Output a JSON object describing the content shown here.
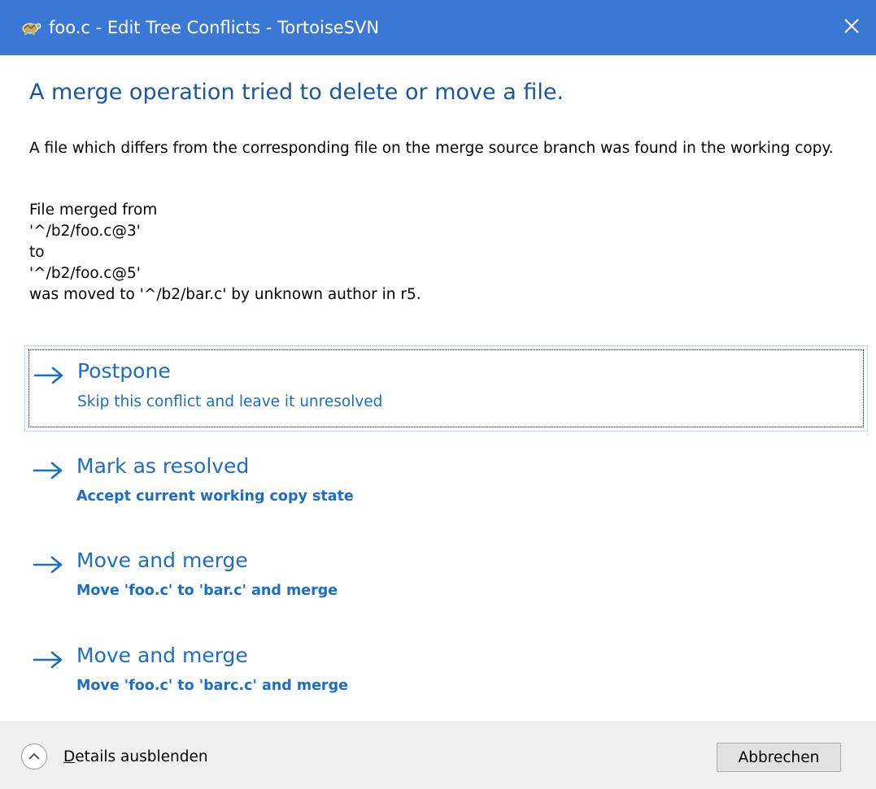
{
  "window": {
    "title": "foo.c - Edit Tree Conflicts - TortoiseSVN",
    "app_icon": "tortoise-icon",
    "close_icon": "close-icon",
    "titlebar_color": "#3b78d6"
  },
  "main_instruction": "A merge operation tried to delete or move a file.",
  "description": "A file which differs from the corresponding file on the merge source branch was found in the working copy.",
  "details": [
    "File merged from",
    "'^/b2/foo.c@3'",
    "to",
    "'^/b2/foo.c@5'",
    "was moved to '^/b2/bar.c' by unknown author in r5."
  ],
  "commands": [
    {
      "title": "Postpone",
      "subtitle": "Skip this conflict and leave it unresolved",
      "icon": "arrow-right-icon"
    },
    {
      "title": "Mark as resolved",
      "subtitle": "Accept current working copy state",
      "icon": "arrow-right-icon"
    },
    {
      "title": "Move and merge",
      "subtitle": "Move 'foo.c' to 'bar.c' and merge",
      "icon": "arrow-right-icon"
    },
    {
      "title": "Move and merge",
      "subtitle": "Move 'foo.c' to 'barc.c' and merge",
      "icon": "arrow-right-icon"
    }
  ],
  "footer": {
    "expander_accel": "D",
    "expander_rest": "etails ausblenden",
    "expander_icon": "chevron-up-icon",
    "cancel_label": "Abbrechen"
  },
  "colors": {
    "link": "#1c6ec4",
    "instruction": "#1a56a8"
  }
}
